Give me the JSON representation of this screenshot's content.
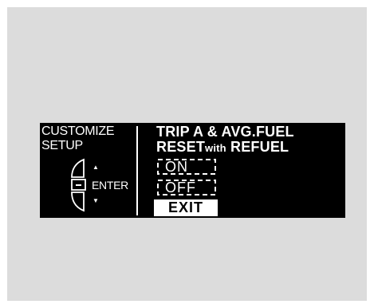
{
  "display": {
    "left_title_line1": "CUSTOMIZE",
    "left_title_line2": "SETUP",
    "enter_label": "ENTER",
    "up_arrow": "▲",
    "down_arrow": "▼",
    "menu_title_line1": "TRIP A & AVG.FUEL",
    "menu_title_line2_a": "RESET",
    "menu_title_line2_b": "with",
    "menu_title_line2_c": "REFUEL",
    "options": [
      {
        "label": "ON"
      },
      {
        "label": "OFF"
      }
    ],
    "exit_label": "EXIT"
  },
  "colors": {
    "frame_background": "#dcdcdc",
    "display_background": "#000000",
    "display_foreground": "#ffffff"
  },
  "icons": {
    "selector_knob": "selector-knob-icon",
    "up": "up-arrow-icon",
    "down": "down-arrow-icon"
  }
}
